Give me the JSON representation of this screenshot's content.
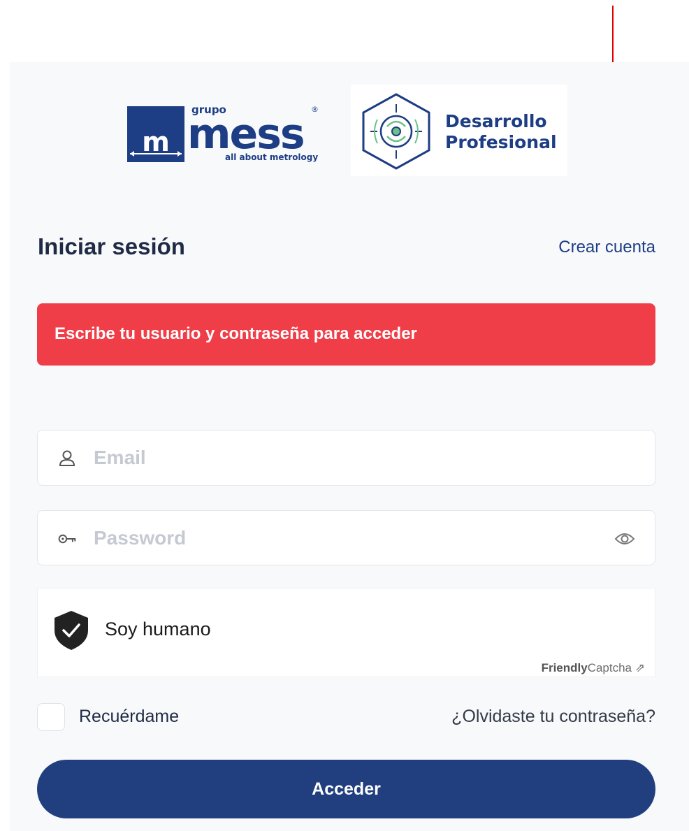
{
  "logos": {
    "mess_small": "grupo",
    "mess_main": "mess",
    "mess_tagline": "all about metrology",
    "mess_mark": "m",
    "mess_registered": "®",
    "dp_line1": "Desarrollo",
    "dp_line2": "Profesional"
  },
  "header": {
    "title": "Iniciar sesión",
    "create_account": "Crear cuenta"
  },
  "alert": {
    "message": "Escribe tu usuario y contraseña para acceder",
    "color": "#f03e48"
  },
  "form": {
    "email_placeholder": "Email",
    "password_placeholder": "Password",
    "email_icon": "user-icon",
    "password_icon": "key-icon",
    "toggle_icon": "eye-icon"
  },
  "captcha": {
    "label": "Soy humano",
    "brand_bold": "Friendly",
    "brand_rest": "Captcha",
    "brand_arrow": "⇗"
  },
  "options": {
    "remember": "Recuérdame",
    "forgot": "¿Olvidaste tu contraseña?"
  },
  "submit": {
    "label": "Acceder",
    "color": "#213f7f"
  },
  "accent": "#1d3d84",
  "annotation_color": "#e00000"
}
